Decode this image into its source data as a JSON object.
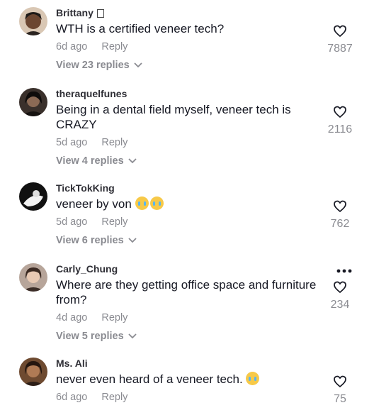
{
  "comments": [
    {
      "username": "Brittany",
      "text": "WTH is a certified veneer tech?",
      "time": "6d ago",
      "reply": "Reply",
      "replies": "View 23 replies",
      "likes": "7887"
    },
    {
      "username": "theraquelfunes",
      "text": "Being in a dental field myself, veneer tech is CRAZY",
      "time": "5d ago",
      "reply": "Reply",
      "replies": "View 4 replies",
      "likes": "2116"
    },
    {
      "username": "TickTokKing",
      "text": "veneer by von",
      "time": "5d ago",
      "reply": "Reply",
      "replies": "View 6 replies",
      "likes": "762"
    },
    {
      "username": "Carly_Chung",
      "text": "Where are they getting office space and furniture from?",
      "time": "4d ago",
      "reply": "Reply",
      "replies": "View 5 replies",
      "likes": "234"
    },
    {
      "username": "Ms. Ali",
      "text": "never even heard of a veneer tech.",
      "time": "6d ago",
      "reply": "Reply",
      "likes": "75"
    }
  ],
  "icons": {
    "like": "heart-outline-icon",
    "more": "more-dots-icon",
    "chevron": "chevron-down-icon",
    "emoji": "crying-face-emoji"
  },
  "colors": {
    "text": "#161823",
    "muted": "#8a8b91"
  }
}
